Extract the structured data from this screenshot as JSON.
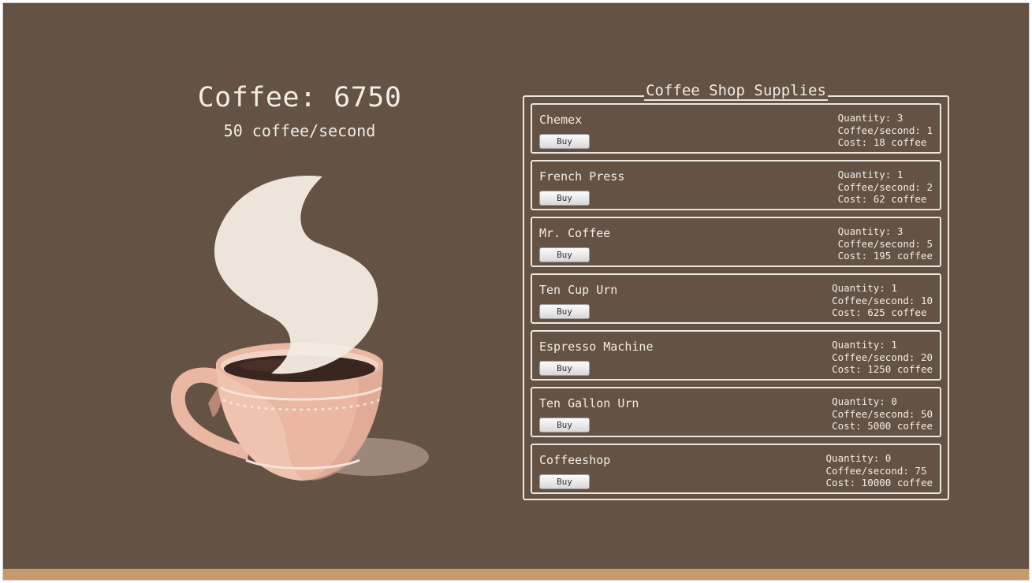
{
  "counter": {
    "coffee_label": "Coffee: 6750",
    "rate_label": "50 coffee/second"
  },
  "store": {
    "title": "Coffee Shop Supplies",
    "buy_label": "Buy",
    "items": [
      {
        "name": "Chemex",
        "quantity": "Quantity: 3",
        "cps": "Coffee/second: 1",
        "cost": "Cost: 18 coffee"
      },
      {
        "name": "French Press",
        "quantity": "Quantity: 1",
        "cps": "Coffee/second: 2",
        "cost": "Cost: 62 coffee"
      },
      {
        "name": "Mr. Coffee",
        "quantity": "Quantity: 3",
        "cps": "Coffee/second: 5",
        "cost": "Cost: 195 coffee"
      },
      {
        "name": "Ten Cup Urn",
        "quantity": "Quantity: 1",
        "cps": "Coffee/second: 10",
        "cost": "Cost: 625 coffee"
      },
      {
        "name": "Espresso Machine",
        "quantity": "Quantity: 1",
        "cps": "Coffee/second: 20",
        "cost": "Cost: 1250 coffee"
      },
      {
        "name": "Ten Gallon Urn",
        "quantity": "Quantity: 0",
        "cps": "Coffee/second: 50",
        "cost": "Cost: 5000 coffee"
      },
      {
        "name": "Coffeeshop",
        "quantity": "Quantity: 0",
        "cps": "Coffee/second: 75",
        "cost": "Cost: 10000 coffee"
      }
    ]
  },
  "colors": {
    "background": "#645245",
    "floor": "#c69a6d",
    "text": "#f3ede6",
    "cup": "#e7b5a0",
    "steam": "#f4ebe1",
    "coffee": "#3a2620"
  },
  "icons": {
    "cup": "coffee-cup-icon"
  }
}
